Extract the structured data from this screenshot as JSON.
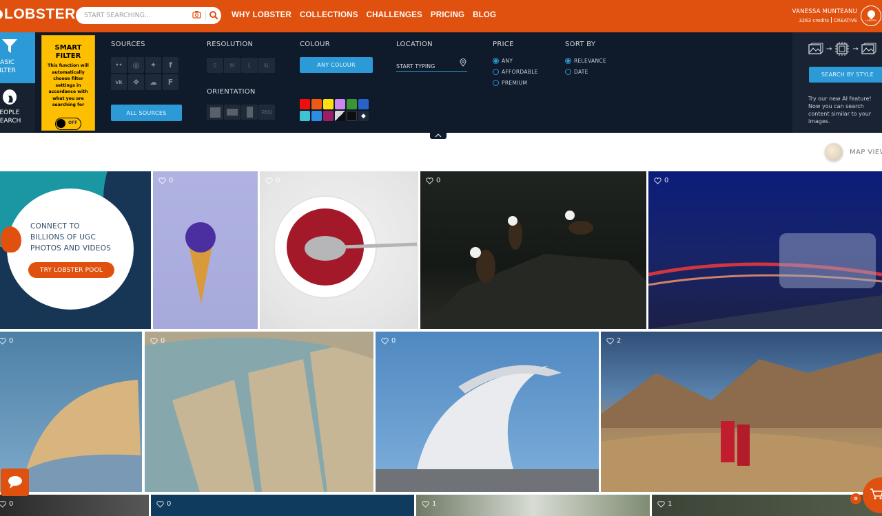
{
  "header": {
    "logo": "LOBSTER",
    "search": {
      "placeholder": "START SEARCHING...",
      "value": ""
    },
    "nav": [
      "WHY LOBSTER",
      "COLLECTIONS",
      "CHALLENGES",
      "PRICING",
      "BLOG"
    ],
    "user": {
      "name": "VANESSA MUNTEANU",
      "credits": "3263 credits",
      "plan": "CREATIVE",
      "avatar_label": "LOBSTER"
    }
  },
  "filters": {
    "modes": [
      {
        "label": "BASIC FILTER",
        "icon": "funnel-icon",
        "active": true
      },
      {
        "label": "PEOPLE SEARCH",
        "icon": "face-icon",
        "active": false
      }
    ],
    "smart_filter": {
      "title": "SMART FILTER",
      "description": "This function will automatically choose filter settings in accordance with what you are searching for",
      "toggle_state": "OFF"
    },
    "sources": {
      "title": "SOURCES",
      "items": [
        {
          "name": "flickr",
          "glyph": "••"
        },
        {
          "name": "instagram",
          "glyph": "◎"
        },
        {
          "name": "pinwheel",
          "glyph": "✦"
        },
        {
          "name": "facebook",
          "glyph": "f"
        },
        {
          "name": "vk",
          "glyph": "vk"
        },
        {
          "name": "dropbox",
          "glyph": "❖"
        },
        {
          "name": "cloud",
          "glyph": "☁"
        },
        {
          "name": "foursquare",
          "glyph": "F"
        }
      ],
      "all_button": "ALL SOURCES"
    },
    "resolution": {
      "title": "RESOLUTION",
      "options": [
        "S",
        "M",
        "L",
        "XL"
      ]
    },
    "orientation": {
      "title": "ORIENTATION",
      "options": [
        "square",
        "landscape",
        "portrait",
        "PAN"
      ],
      "pan_label": "PAN"
    },
    "colour": {
      "title": "COLOUR",
      "any_button": "ANY COLOUR",
      "swatches": [
        "#f00f0f",
        "#ec5a14",
        "#fde014",
        "#cc86ee",
        "#3b9535",
        "#2a63c8",
        "#3ec3d4",
        "#2d8de3",
        "#9b1f68",
        "split-bw",
        "#0e0e0e",
        "paint-bucket"
      ]
    },
    "location": {
      "title": "LOCATION",
      "placeholder": "START TYPING"
    },
    "price": {
      "title": "PRICE",
      "options": [
        "ANY",
        "AFFORDABLE",
        "PREMIUM"
      ],
      "selected": "ANY"
    },
    "sort_by": {
      "title": "SORT BY",
      "options": [
        "RELEVANCE",
        "DATE"
      ],
      "selected": "RELEVANCE"
    },
    "ai": {
      "button": "SEARCH BY STYLE",
      "text": "Try our new AI feature! Now you can search content similar to your images."
    }
  },
  "map_view": {
    "label": "MAP VIEW"
  },
  "promo": {
    "text": "CONNECT TO BILLIONS OF UGC PHOTOS AND VIDEOS",
    "button": "TRY LOBSTER POOL"
  },
  "tiles": [
    {
      "subject": "purple-ice-cream-cone",
      "likes": "0"
    },
    {
      "subject": "red-berries-in-bowl",
      "likes": "0"
    },
    {
      "subject": "bald-eagles-on-rock",
      "likes": "0"
    },
    {
      "subject": "city-night-light-trails",
      "likes": "0"
    },
    {
      "subject": "curved-architecture-1",
      "likes": "0"
    },
    {
      "subject": "curved-architecture-2",
      "likes": "0"
    },
    {
      "subject": "opera-house",
      "likes": "0"
    },
    {
      "subject": "mountain-valley-couple",
      "likes": "2"
    },
    {
      "subject": "bw-animal",
      "likes": "0"
    },
    {
      "subject": "dark-blue",
      "likes": "0"
    },
    {
      "subject": "forest-1",
      "likes": "1"
    },
    {
      "subject": "forest-2",
      "likes": "1"
    }
  ],
  "cart": {
    "count": "0"
  }
}
